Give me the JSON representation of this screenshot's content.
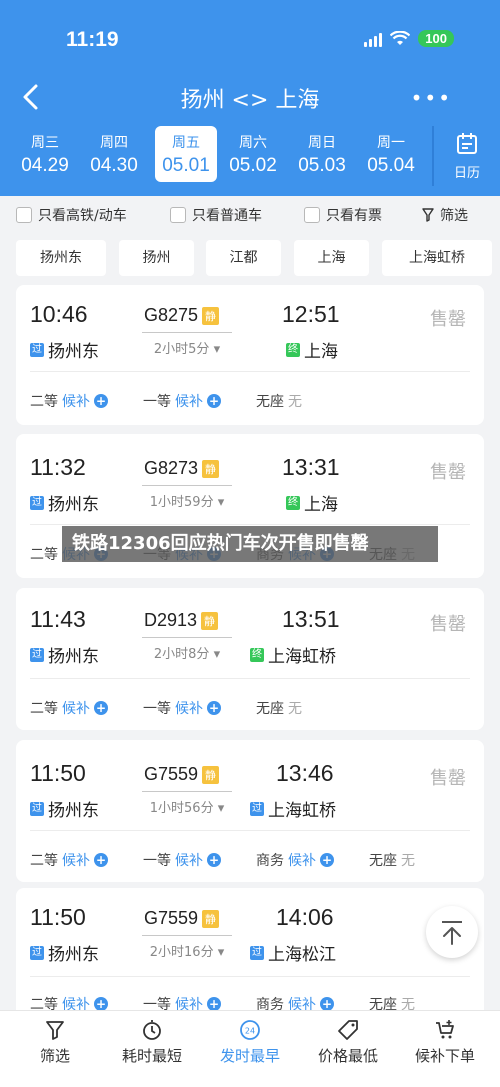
{
  "status": {
    "time": "11:19",
    "battery": "100"
  },
  "nav": {
    "title": "扬州 <> 上海"
  },
  "dates": [
    {
      "weekday": "周三",
      "date": "04.29"
    },
    {
      "weekday": "周四",
      "date": "04.30"
    },
    {
      "weekday": "周五",
      "date": "05.01",
      "active": true
    },
    {
      "weekday": "周六",
      "date": "05.02"
    },
    {
      "weekday": "周日",
      "date": "05.03"
    },
    {
      "weekday": "周一",
      "date": "05.04"
    }
  ],
  "calendar_label": "日历",
  "filters": {
    "high_speed": "只看高铁/动车",
    "normal": "只看普通车",
    "available": "只看有票",
    "screen": "筛选"
  },
  "stations": [
    "扬州东",
    "扬州",
    "江都",
    "上海",
    "上海虹桥"
  ],
  "trains": [
    {
      "depart_time": "10:46",
      "depart_station": "扬州东",
      "depart_tag": "过",
      "train_no": "G8275",
      "quiet": "静",
      "duration": "2小时5分",
      "arrive_time": "12:51",
      "arrive_station": "上海",
      "arrive_tag": "终",
      "status": "售罄",
      "seats": [
        {
          "class": "二等",
          "state": "候补",
          "type": "waitlist"
        },
        {
          "class": "一等",
          "state": "候补",
          "type": "waitlist"
        },
        {
          "class": "无座",
          "state": "无",
          "type": "none"
        }
      ]
    },
    {
      "depart_time": "11:32",
      "depart_station": "扬州东",
      "depart_tag": "过",
      "train_no": "G8273",
      "quiet": "静",
      "duration": "1小时59分",
      "arrive_time": "13:31",
      "arrive_station": "上海",
      "arrive_tag": "终",
      "status": "售罄",
      "seats": [
        {
          "class": "二等",
          "state": "候补",
          "type": "waitlist"
        },
        {
          "class": "一等",
          "state": "候补",
          "type": "waitlist"
        },
        {
          "class": "商务",
          "state": "候补",
          "type": "waitlist"
        },
        {
          "class": "无座",
          "state": "无",
          "type": "none"
        }
      ]
    },
    {
      "depart_time": "11:43",
      "depart_station": "扬州东",
      "depart_tag": "过",
      "train_no": "D2913",
      "quiet": "静",
      "duration": "2小时8分",
      "arrive_time": "13:51",
      "arrive_station": "上海虹桥",
      "arrive_tag": "终",
      "status": "售罄",
      "seats": [
        {
          "class": "二等",
          "state": "候补",
          "type": "waitlist"
        },
        {
          "class": "一等",
          "state": "候补",
          "type": "waitlist"
        },
        {
          "class": "无座",
          "state": "无",
          "type": "none"
        }
      ]
    },
    {
      "depart_time": "11:50",
      "depart_station": "扬州东",
      "depart_tag": "过",
      "train_no": "G7559",
      "quiet": "静",
      "duration": "1小时56分",
      "arrive_time": "13:46",
      "arrive_station": "上海虹桥",
      "arrive_tag": "过",
      "status": "售罄",
      "seats": [
        {
          "class": "二等",
          "state": "候补",
          "type": "waitlist"
        },
        {
          "class": "一等",
          "state": "候补",
          "type": "waitlist"
        },
        {
          "class": "商务",
          "state": "候补",
          "type": "waitlist"
        },
        {
          "class": "无座",
          "state": "无",
          "type": "none"
        }
      ]
    },
    {
      "depart_time": "11:50",
      "depart_station": "扬州东",
      "depart_tag": "过",
      "train_no": "G7559",
      "quiet": "静",
      "duration": "2小时16分",
      "arrive_time": "14:06",
      "arrive_station": "上海松江",
      "arrive_tag": "过",
      "status": "",
      "seats": [
        {
          "class": "二等",
          "state": "候补",
          "type": "waitlist"
        },
        {
          "class": "一等",
          "state": "候补",
          "type": "waitlist"
        },
        {
          "class": "商务",
          "state": "候补",
          "type": "waitlist"
        },
        {
          "class": "无座",
          "state": "无",
          "type": "none"
        }
      ]
    }
  ],
  "overlay_caption": "铁路12306回应热门车次开售即售罄",
  "bottom_bar": [
    {
      "label": "筛选",
      "icon": "filter-icon"
    },
    {
      "label": "耗时最短",
      "icon": "clock-icon"
    },
    {
      "label": "发时最早",
      "icon": "24h-icon",
      "active": true,
      "badge": "24"
    },
    {
      "label": "价格最低",
      "icon": "price-tag-icon"
    },
    {
      "label": "候补下单",
      "icon": "cart-icon"
    }
  ],
  "colors": {
    "brand": "#3e93ec",
    "sold_out": "#b5b5b5",
    "quiet_badge": "#f6c23e",
    "terminal_tag": "#35c759"
  }
}
